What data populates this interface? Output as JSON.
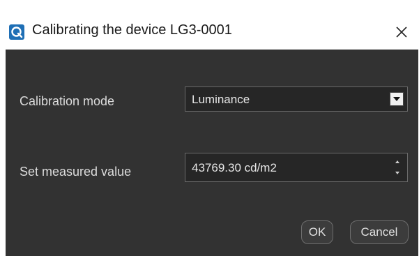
{
  "window": {
    "title": "Calibrating the device LG3-0001",
    "icon": "app-logo-icon",
    "close_icon": "close-icon"
  },
  "form": {
    "calibration_mode_label": "Calibration mode",
    "calibration_mode_value": "Luminance",
    "measured_value_label": "Set measured value",
    "measured_value": "43769.30 cd/m2"
  },
  "buttons": {
    "ok_label": "OK",
    "cancel_label": "Cancel"
  },
  "colors": {
    "content_background": "#323232",
    "accent": "#1f6fb5"
  }
}
